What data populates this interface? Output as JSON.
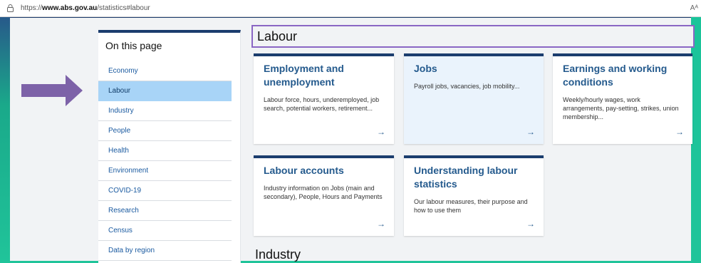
{
  "browser": {
    "url_prefix": "https://",
    "url_domain": "www.abs.gov.au",
    "url_path": "/statistics#labour",
    "reader_icon": "Aᴬ"
  },
  "sidebar": {
    "title": "On this page",
    "items": [
      {
        "label": "Economy"
      },
      {
        "label": "Labour"
      },
      {
        "label": "Industry"
      },
      {
        "label": "People"
      },
      {
        "label": "Health"
      },
      {
        "label": "Environment"
      },
      {
        "label": "COVID-19"
      },
      {
        "label": "Research"
      },
      {
        "label": "Census"
      },
      {
        "label": "Data by region"
      }
    ],
    "active_item": "Labour"
  },
  "main": {
    "section_title": "Labour",
    "next_section_title": "Industry",
    "cards": [
      {
        "title": "Employment and unemployment",
        "desc": "Labour force, hours, underemployed, job search, potential workers, retirement...",
        "arrow": "→"
      },
      {
        "title": "Jobs",
        "desc": "Payroll jobs, vacancies, job mobility...",
        "arrow": "→"
      },
      {
        "title": "Earnings and working conditions",
        "desc": "Weekly/hourly wages, work arrangements, pay-setting, strikes, union membership...",
        "arrow": "→"
      },
      {
        "title": "Labour accounts",
        "desc": "Industry information on Jobs (main and secondary), People, Hours and Payments",
        "arrow": "→"
      },
      {
        "title": "Understanding labour statistics",
        "desc": "Our labour measures, their purpose and how to use them",
        "arrow": "→"
      }
    ]
  },
  "colors": {
    "accent_purple": "#8a66c4",
    "card_border": "#1b3d6e",
    "link_blue": "#245a8d",
    "active_bg": "#a8d4f7"
  },
  "icons": {
    "lock": "lock-icon",
    "pointer_arrow": "pointer-arrow-icon",
    "card_arrow": "arrow-right-icon"
  }
}
